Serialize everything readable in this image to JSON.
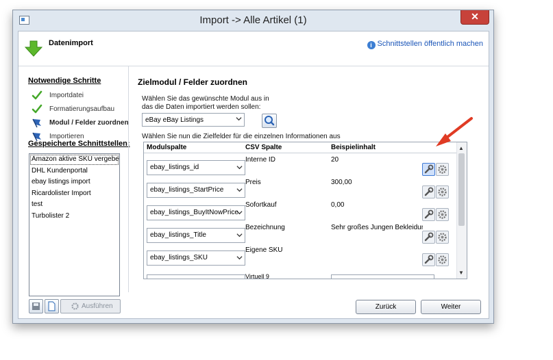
{
  "window": {
    "title": "Import -> Alle Artikel (1)",
    "close_label": "✕"
  },
  "header": {
    "title": "Datenimport",
    "info_link": "Schnittstellen öffentlich machen"
  },
  "steps": {
    "heading": "Notwendige Schritte",
    "items": [
      {
        "label": "Importdatei",
        "state": "done"
      },
      {
        "label": "Formatierungsaufbau",
        "state": "done"
      },
      {
        "label": "Modul / Felder zuordnen",
        "state": "current"
      },
      {
        "label": "Importieren",
        "state": "pending"
      }
    ]
  },
  "saved": {
    "heading": "Gespeicherte Schnittstellen:",
    "items": [
      "Amazon aktive SKU vergeben",
      "DHL Kundenportal",
      "ebay listings import",
      "Ricardolister Import",
      "test",
      "Turbolister 2"
    ]
  },
  "main": {
    "title": "Zielmodul / Felder zuordnen",
    "module_hint_line1": "Wählen Sie das gewünschte Modul aus in",
    "module_hint_line2": "das die Daten importiert werden sollen:",
    "module_value": "eBay eBay Listings",
    "fields_hint": "Wählen Sie nun die Zielfelder für die einzelnen Informationen aus"
  },
  "grid": {
    "columns": [
      "Modulspalte",
      "CSV Spalte",
      "Beispielinhalt"
    ],
    "rows": [
      {
        "module": "ebay_listings_id",
        "csv": "Interne ID",
        "sample": "20"
      },
      {
        "module": "ebay_listings_StartPrice",
        "csv": "Preis",
        "sample": "300,00"
      },
      {
        "module": "ebay_listings_BuyItNowPrice",
        "csv": "Sofortkauf",
        "sample": "0,00"
      },
      {
        "module": "ebay_listings_Title",
        "csv": "Bezeichnung",
        "sample": "Sehr großes Jungen Bekleidungs"
      },
      {
        "module": "ebay_listings_SKU",
        "csv": "Eigene SKU",
        "sample": ""
      }
    ],
    "partial_csv": "Virtuell 9"
  },
  "footer": {
    "run_label": "Ausführen",
    "back_label": "Zurück",
    "next_label": "Weiter"
  },
  "colors": {
    "accent": "#3c7ed3",
    "close": "#c7423a",
    "done_check": "#45a82a",
    "flag": "#2e64b6",
    "annotation_arrow": "#e03b24"
  }
}
